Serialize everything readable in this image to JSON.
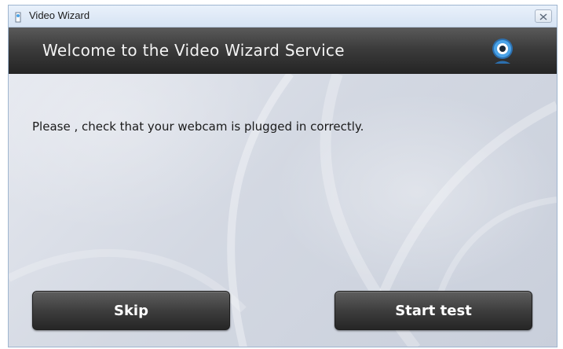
{
  "window": {
    "title": "Video Wizard",
    "close_icon": "close-icon"
  },
  "header": {
    "title": "Welcome to the Video Wizard Service",
    "icon": "webcam-icon"
  },
  "content": {
    "message": "Please , check that your webcam is plugged in correctly."
  },
  "buttons": {
    "skip_label": "Skip",
    "start_label": "Start test"
  },
  "colors": {
    "header_bg": "#3c3c3c",
    "button_bg": "#3e3e3e",
    "webcam_accent": "#4aa3e8"
  }
}
